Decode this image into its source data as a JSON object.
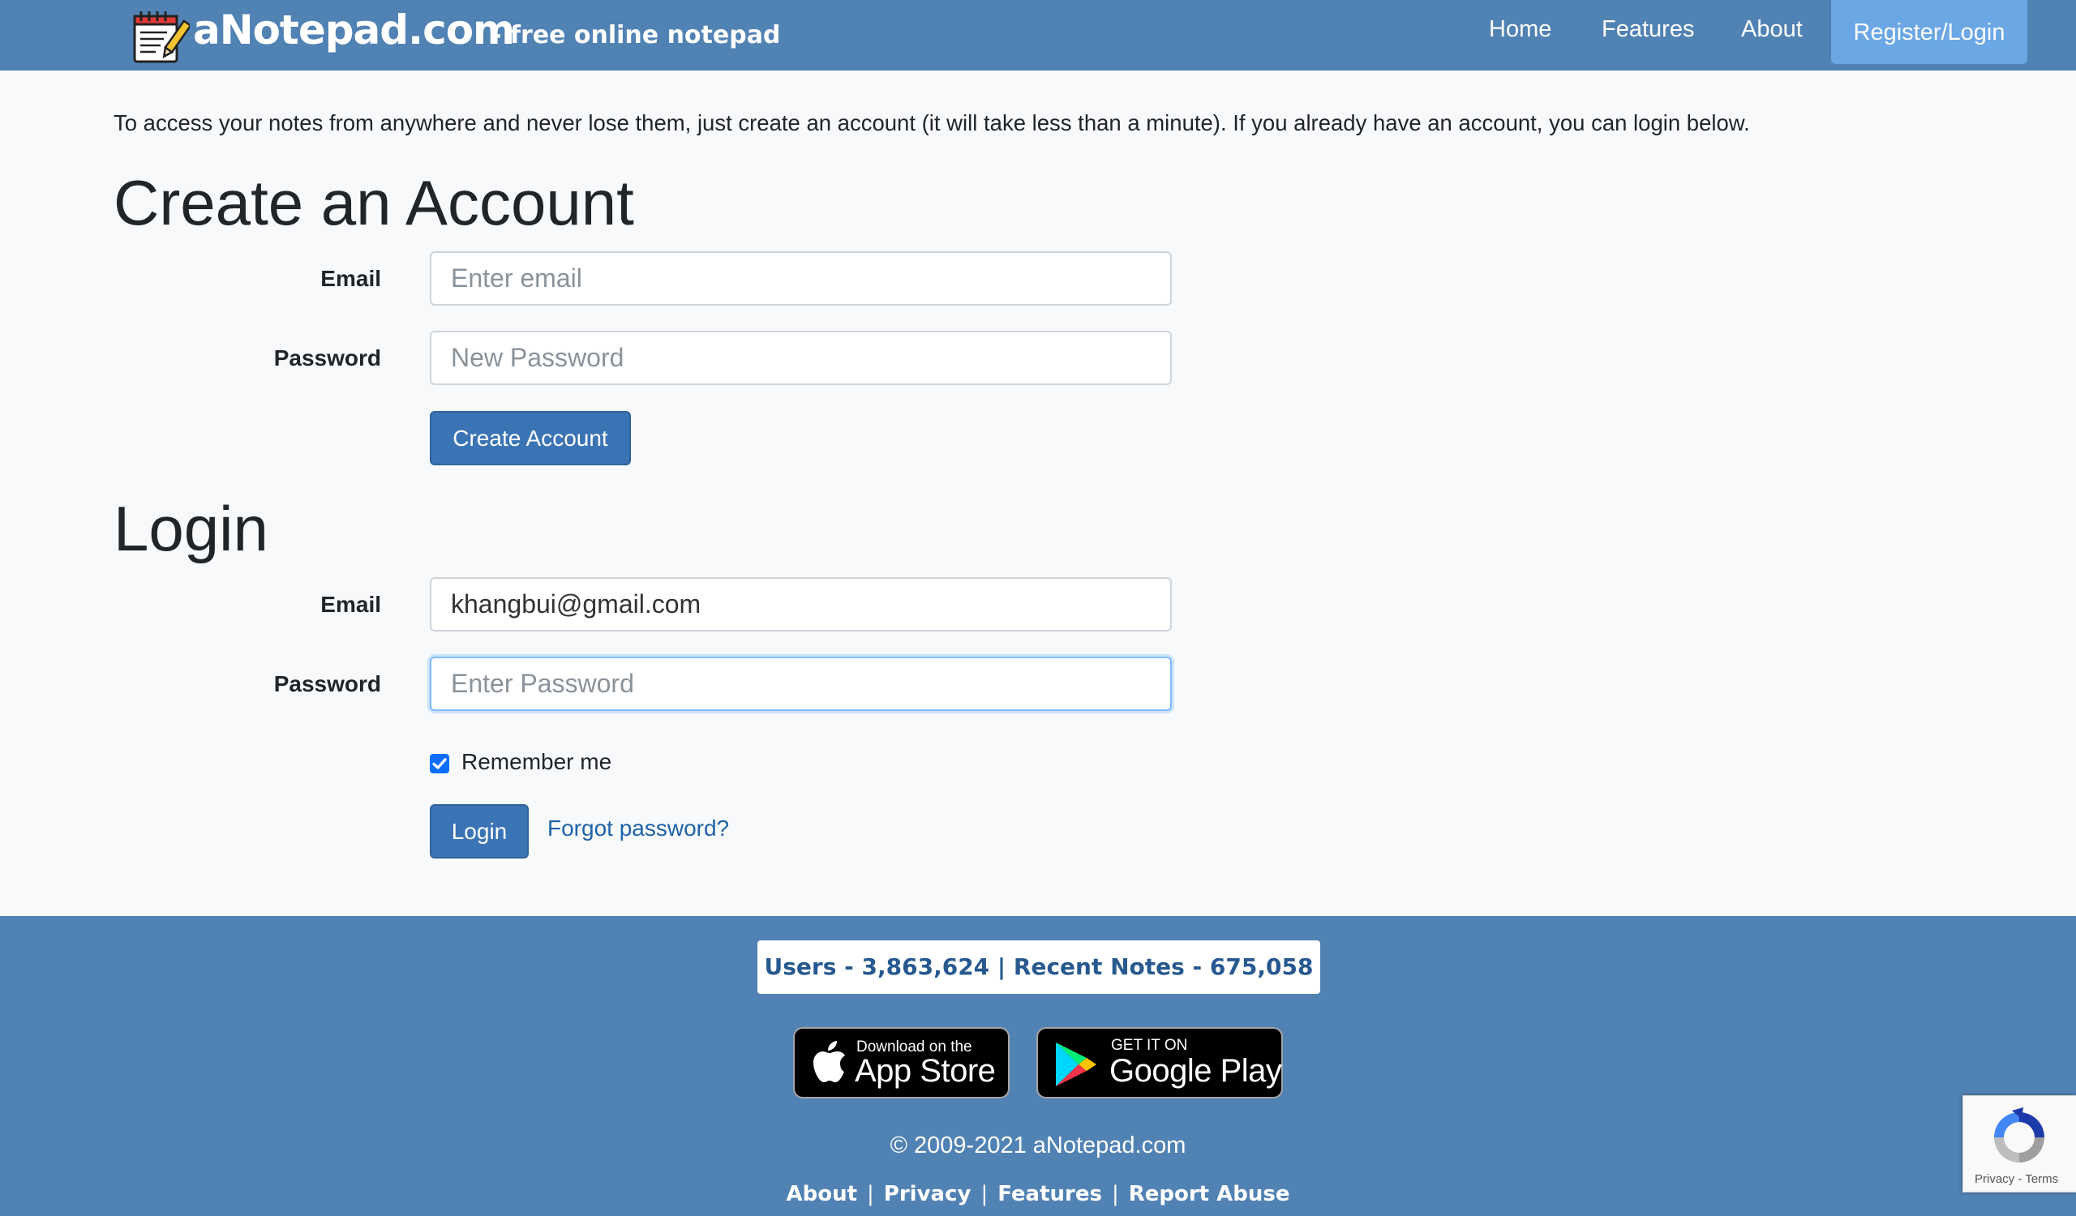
{
  "brand": {
    "name": "aNotepad.com",
    "tagline": "- free online notepad"
  },
  "nav": {
    "home": "Home",
    "features": "Features",
    "about": "About",
    "register_login": "Register/Login"
  },
  "intro": "To access your notes from anywhere and never lose them, just create an account (it will take less than a minute). If you already have an account, you can login below.",
  "create_account": {
    "heading": "Create an Account",
    "email_label": "Email",
    "email_placeholder": "Enter email",
    "password_label": "Password",
    "password_placeholder": "New Password",
    "submit_label": "Create Account"
  },
  "login": {
    "heading": "Login",
    "email_label": "Email",
    "email_value": "khangbui@gmail.com",
    "password_label": "Password",
    "password_placeholder": "Enter Password",
    "remember_label": "Remember me",
    "remember_checked": true,
    "submit_label": "Login",
    "forgot_label": "Forgot password?"
  },
  "footer": {
    "stats": "Users - 3,863,624 | Recent Notes - 675,058",
    "app_store": {
      "small": "Download on the",
      "big": "App Store"
    },
    "google_play": {
      "small": "GET IT ON",
      "big": "Google Play"
    },
    "copyright": "© 2009-2021 aNotepad.com",
    "links": [
      "About",
      "Privacy",
      "Features",
      "Report Abuse"
    ]
  },
  "recaptcha": {
    "text": "Privacy - Terms"
  },
  "colors": {
    "nav_bg": "#5182b4",
    "nav_active": "#6ba7e5",
    "button": "#3a74b4",
    "link": "#1e63a7",
    "stats_text": "#27598f"
  }
}
